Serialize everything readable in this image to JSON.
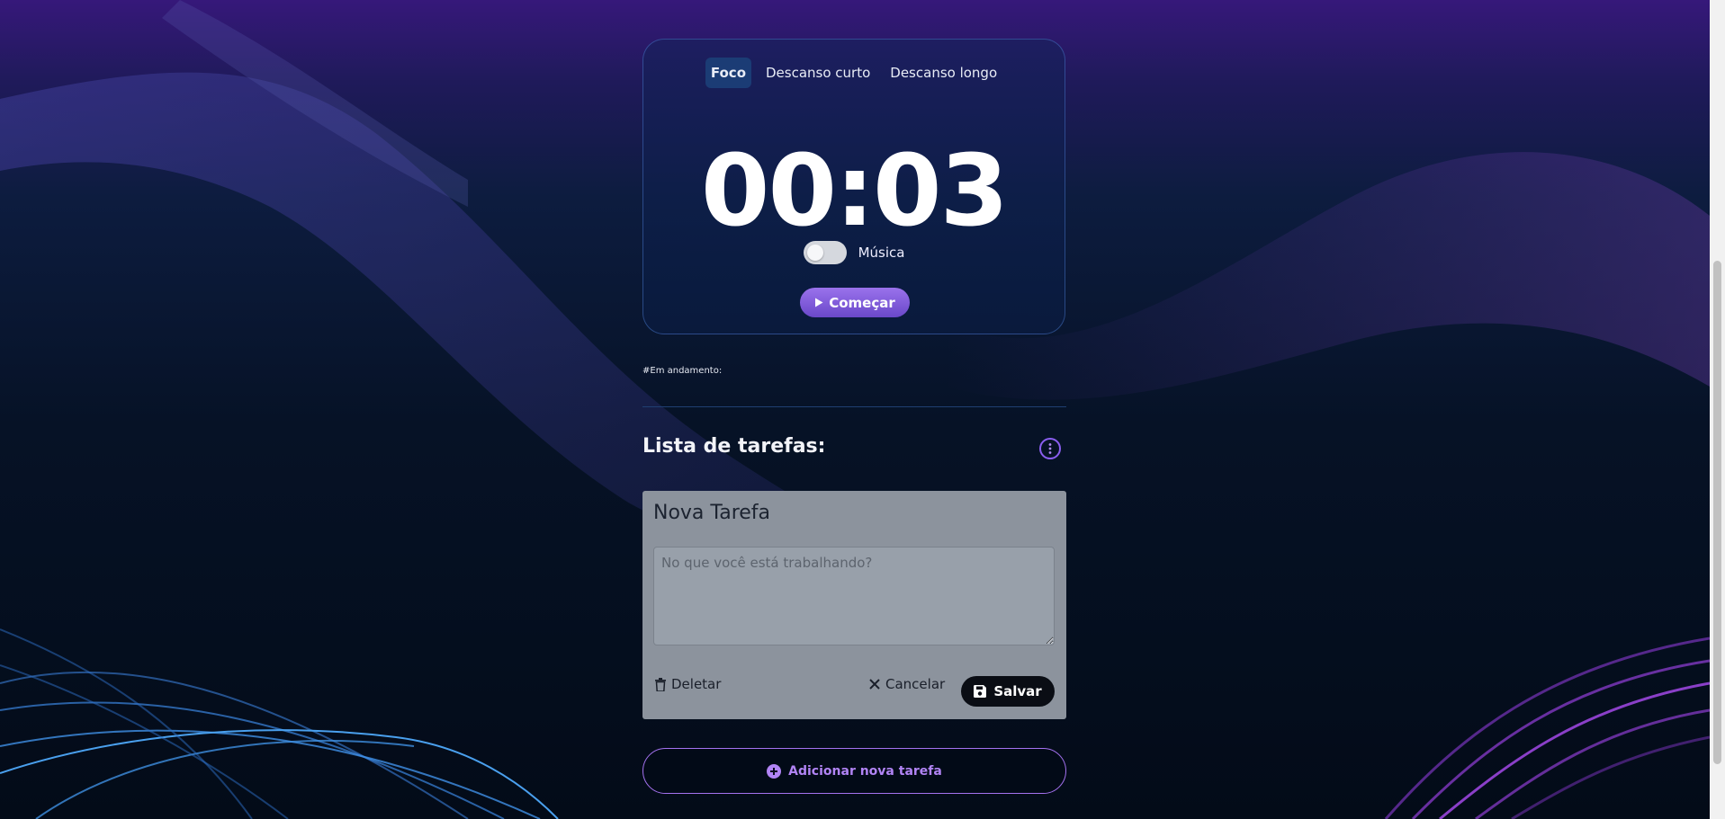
{
  "timer": {
    "modes": [
      {
        "label": "Foco",
        "active": true
      },
      {
        "label": "Descanso curto",
        "active": false
      },
      {
        "label": "Descanso longo",
        "active": false
      }
    ],
    "time": "00:03",
    "music_label": "Música",
    "music_on": false,
    "start_label": "Começar"
  },
  "in_progress_label": "#Em andamento:",
  "task_list": {
    "title": "Lista de tarefas:"
  },
  "task_form": {
    "heading": "Nova Tarefa",
    "placeholder": "No que você está trabalhando?",
    "value": "",
    "delete_label": "Deletar",
    "cancel_label": "Cancelar",
    "save_label": "Salvar"
  },
  "add_task_label": "Adicionar nova tarefa",
  "colors": {
    "accent": "#8a5ef0",
    "card_bg": "#8c939d",
    "active_tab": "#1b3c75"
  }
}
